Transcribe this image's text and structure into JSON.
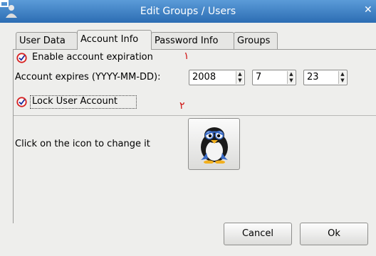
{
  "window": {
    "title": "Edit Groups / Users",
    "close_glyph": "✕"
  },
  "tabs": [
    {
      "label": "User Data"
    },
    {
      "label": "Account Info"
    },
    {
      "label": "Password Info"
    },
    {
      "label": "Groups"
    }
  ],
  "account": {
    "enable_expiration_label": "Enable account expiration",
    "enable_expiration_checked": true,
    "annotation_1": "١",
    "expires_label": "Account expires (YYYY-MM-DD):",
    "year": "2008",
    "month": "7",
    "day": "23",
    "lock_label": "Lock User Account",
    "lock_checked": true,
    "annotation_2": "٢",
    "icon_hint": "Click on the icon to change it",
    "user_icon": "penguin-icon"
  },
  "buttons": {
    "cancel": "Cancel",
    "ok": "Ok"
  },
  "colors": {
    "titlebar": "#2c6db3",
    "check_ring": "#d62020",
    "annotation": "#d01010"
  }
}
